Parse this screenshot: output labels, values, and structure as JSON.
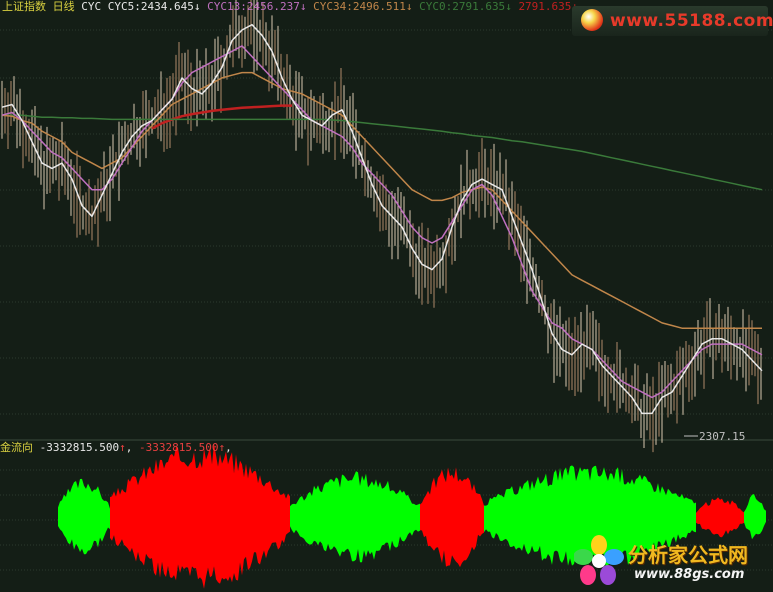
{
  "header": {
    "index_name": "上证指数",
    "period": "日线",
    "indicator": "CYC",
    "items": [
      {
        "label": "CYC5:",
        "value": "2434.645",
        "arrow": "↓",
        "color": "#e8e8e8"
      },
      {
        "label": "CYC13:",
        "value": "2456.237",
        "arrow": "↓",
        "color": "#c070c0"
      },
      {
        "label": "CYC34:",
        "value": "2496.511",
        "arrow": "↓",
        "color": "#c0864a"
      },
      {
        "label": "CYC0:",
        "value": "2791.635",
        "arrow": "↓",
        "color": "#3a7a3a"
      },
      {
        "label": "",
        "value": "2791.635",
        "arrow": "↓",
        "color": "#c02020"
      }
    ]
  },
  "low_marker": "2307.15",
  "sub_header": {
    "name": "金流向",
    "value1": "-3332815.500",
    "arrow1": "↑",
    "value2": "-3332815.500",
    "arrow2": "↑",
    "sep": ","
  },
  "watermark_top": {
    "text": "www.55188.com"
  },
  "watermark_bottom": {
    "title": "分析家公式网",
    "url": "www.88gs.com"
  },
  "chart_data": [
    {
      "type": "line",
      "title": "",
      "ylim": [
        2280,
        3080
      ],
      "x": [
        0,
        10,
        20,
        30,
        40,
        50,
        60,
        70,
        80,
        90,
        100,
        110,
        120,
        130,
        140,
        150,
        160,
        170,
        180,
        190,
        200,
        210,
        220,
        230,
        240,
        250,
        260,
        270,
        280,
        290,
        300,
        310,
        320,
        330,
        340,
        350,
        360,
        370,
        380,
        390,
        400,
        410,
        420,
        430,
        440,
        450,
        460,
        470,
        480,
        490,
        500,
        510,
        520,
        530,
        540,
        550,
        560,
        570,
        580,
        590,
        600,
        610,
        620,
        630,
        640,
        650,
        660,
        670,
        680,
        690,
        700,
        710,
        720,
        730,
        740,
        750,
        760
      ],
      "series": [
        {
          "name": "CYC5",
          "color": "#e8e8e8",
          "values": [
            2905,
            2910,
            2880,
            2840,
            2800,
            2790,
            2800,
            2770,
            2720,
            2700,
            2740,
            2780,
            2820,
            2850,
            2870,
            2880,
            2900,
            2920,
            2960,
            2940,
            2930,
            2950,
            2980,
            3030,
            3050,
            3060,
            3040,
            3010,
            2960,
            2920,
            2890,
            2880,
            2870,
            2890,
            2900,
            2860,
            2810,
            2760,
            2720,
            2700,
            2680,
            2640,
            2610,
            2600,
            2620,
            2680,
            2730,
            2760,
            2770,
            2760,
            2750,
            2700,
            2650,
            2600,
            2540,
            2480,
            2450,
            2440,
            2460,
            2450,
            2420,
            2400,
            2380,
            2360,
            2330,
            2330,
            2360,
            2370,
            2400,
            2430,
            2460,
            2470,
            2470,
            2460,
            2450,
            2430,
            2410
          ]
        },
        {
          "name": "CYC13",
          "color": "#c070c0",
          "values": [
            2890,
            2895,
            2880,
            2860,
            2840,
            2820,
            2810,
            2790,
            2770,
            2750,
            2750,
            2770,
            2800,
            2830,
            2860,
            2880,
            2900,
            2920,
            2950,
            2970,
            2980,
            2990,
            3000,
            3010,
            3020,
            3000,
            2980,
            2960,
            2940,
            2920,
            2900,
            2880,
            2870,
            2860,
            2850,
            2830,
            2800,
            2780,
            2760,
            2740,
            2710,
            2680,
            2660,
            2650,
            2660,
            2690,
            2720,
            2750,
            2760,
            2740,
            2700,
            2660,
            2610,
            2560,
            2530,
            2500,
            2490,
            2470,
            2460,
            2450,
            2430,
            2410,
            2390,
            2380,
            2370,
            2360,
            2370,
            2390,
            2410,
            2430,
            2450,
            2460,
            2460,
            2460,
            2460,
            2450,
            2440
          ]
        },
        {
          "name": "CYC34",
          "color": "#c0864a",
          "values": [
            2890,
            2888,
            2880,
            2875,
            2860,
            2850,
            2840,
            2820,
            2810,
            2800,
            2790,
            2800,
            2810,
            2830,
            2850,
            2870,
            2890,
            2910,
            2920,
            2930,
            2940,
            2950,
            2960,
            2965,
            2970,
            2970,
            2960,
            2950,
            2940,
            2935,
            2930,
            2920,
            2910,
            2900,
            2890,
            2870,
            2850,
            2830,
            2810,
            2790,
            2770,
            2750,
            2740,
            2730,
            2730,
            2735,
            2745,
            2750,
            2755,
            2750,
            2730,
            2710,
            2690,
            2670,
            2650,
            2630,
            2610,
            2590,
            2580,
            2570,
            2560,
            2550,
            2540,
            2530,
            2520,
            2510,
            2500,
            2495,
            2490,
            2490,
            2490,
            2490,
            2490,
            2490,
            2490,
            2490,
            2490
          ]
        },
        {
          "name": "CYC0",
          "color": "#3a7a3a",
          "values": [
            2890,
            2890,
            2890,
            2888,
            2886,
            2886,
            2885,
            2885,
            2884,
            2884,
            2883,
            2882,
            2882,
            2882,
            2882,
            2882,
            2882,
            2882,
            2882,
            2882,
            2882,
            2882,
            2882,
            2882,
            2882,
            2882,
            2882,
            2882,
            2882,
            2882,
            2882,
            2882,
            2882,
            2881,
            2880,
            2878,
            2876,
            2874,
            2872,
            2870,
            2868,
            2866,
            2864,
            2862,
            2860,
            2857,
            2855,
            2852,
            2850,
            2848,
            2845,
            2842,
            2840,
            2837,
            2834,
            2831,
            2828,
            2825,
            2822,
            2818,
            2814,
            2810,
            2806,
            2802,
            2798,
            2794,
            2790,
            2786,
            2782,
            2778,
            2774,
            2770,
            2766,
            2762,
            2758,
            2754,
            2750
          ]
        },
        {
          "name": "",
          "color": "#c02020",
          "values": [
            null,
            null,
            null,
            null,
            null,
            null,
            null,
            null,
            null,
            null,
            null,
            null,
            null,
            null,
            null,
            2865,
            2875,
            2882,
            2888,
            2892,
            2895,
            2898,
            2900,
            2902,
            2904,
            2905,
            2906,
            2907,
            2908,
            2908,
            null,
            null,
            null,
            null,
            null,
            null,
            null,
            null,
            null,
            null,
            null,
            null,
            null,
            null,
            null,
            null,
            null,
            null,
            null,
            null,
            null,
            null,
            null,
            null,
            null,
            null,
            null,
            null,
            null,
            null,
            null,
            null,
            null,
            null,
            null,
            null,
            null,
            null,
            null,
            null,
            null,
            null,
            null,
            null,
            null,
            null,
            null
          ]
        }
      ]
    },
    {
      "type": "area",
      "title": "金流向",
      "xlim": [
        58,
        766
      ],
      "ylim": [
        -1,
        1
      ],
      "segments": [
        {
          "start": 58,
          "end": 110,
          "color": "#00ff00",
          "amplitude": 0.55
        },
        {
          "start": 110,
          "end": 290,
          "color": "#ff0000",
          "amplitude": 1.0
        },
        {
          "start": 290,
          "end": 420,
          "color": "#00ff00",
          "amplitude": 0.62
        },
        {
          "start": 420,
          "end": 484,
          "color": "#ff0000",
          "amplitude": 0.72
        },
        {
          "start": 484,
          "end": 696,
          "color": "#00ff00",
          "amplitude": 0.72
        },
        {
          "start": 696,
          "end": 744,
          "color": "#ff0000",
          "amplitude": 0.28
        },
        {
          "start": 744,
          "end": 766,
          "color": "#00ff00",
          "amplitude": 0.32
        }
      ]
    }
  ]
}
